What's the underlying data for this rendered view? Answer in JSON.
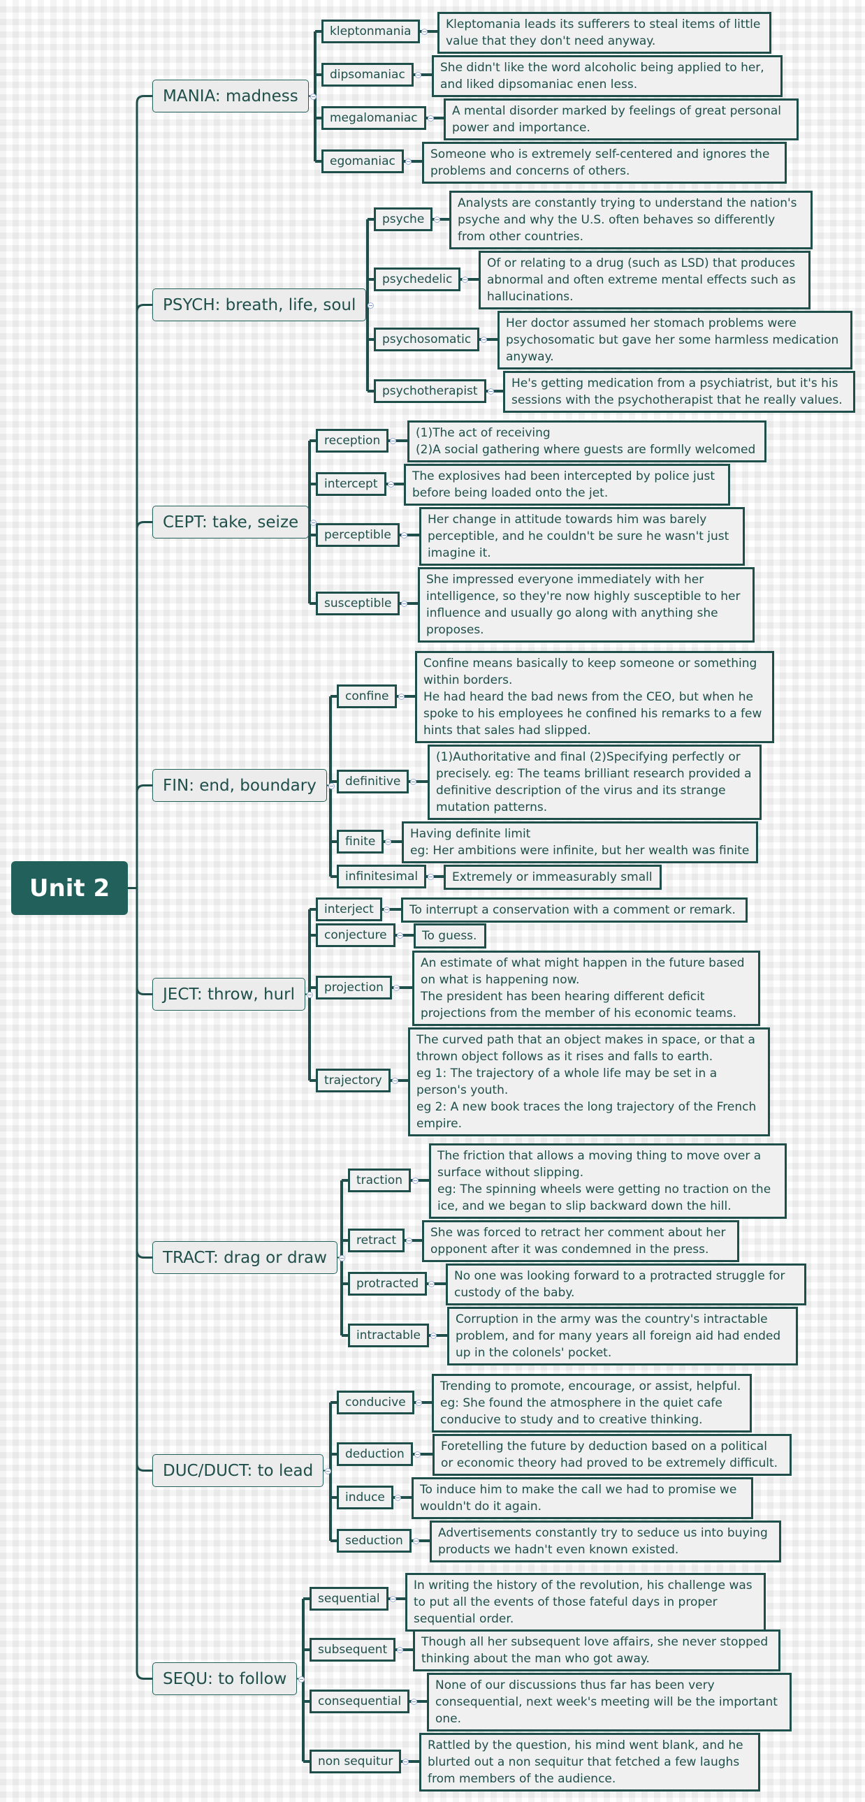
{
  "root": {
    "title": "Unit 2"
  },
  "colors": {
    "accent": "#22605b",
    "line": "#1f4f4a",
    "node_fill": "#ececec",
    "text": "#1f4f4a"
  },
  "categories": [
    {
      "title": "MANIA: madness",
      "children": [
        {
          "word": "kleptonmania",
          "definition": "Kleptomania leads its sufferers to steal items of little\nvalue that they don't need anyway."
        },
        {
          "word": "dipsomaniac",
          "definition": "She didn't like the word alcoholic being applied to her,\nand liked dipsomaniac enen less."
        },
        {
          "word": "megalomaniac",
          "definition": "A mental disorder marked by feelings of great personal\npower and importance."
        },
        {
          "word": "egomaniac",
          "definition": "Someone who is  extremely self-centered and ignores the\nproblems and concerns of others."
        }
      ]
    },
    {
      "title": "PSYCH: breath, life, soul",
      "children": [
        {
          "word": "psyche",
          "definition": "Analysts are constantly trying to understand the nation's\npsyche and why the U.S. often behaves so differently\nfrom other countries."
        },
        {
          "word": "psychedelic",
          "definition": "Of or relating to a drug (such as LSD) that produces\nabnormal and often extreme mental effects such as\nhallucinations."
        },
        {
          "word": "psychosomatic",
          "definition": "Her doctor assumed her stomach problems were\npsychosomatic but gave her some harmless medication\nanyway."
        },
        {
          "word": "psychotherapist",
          "definition": "He's getting medication from a psychiatrist, but it's his\nsessions with the psychotherapist that he really values."
        }
      ]
    },
    {
      "title": "CEPT: take, seize",
      "children": [
        {
          "word": "reception",
          "definition": "(1)The act of receiving\n(2)A social gathering where guests are formlly welcomed"
        },
        {
          "word": "intercept",
          "definition": "The explosives had been intercepted by police just\nbefore being loaded onto the jet."
        },
        {
          "word": "perceptible",
          "definition": "Her change in attitude towards him was barely\nperceptible, and he couldn't be sure he wasn't just\nimagine it."
        },
        {
          "word": "susceptible",
          "definition": "She impressed everyone immediately with her\nintelligence, so they're now highly susceptible to her\ninfluence and usually go along with anything she\nproposes."
        }
      ]
    },
    {
      "title": "FIN: end, boundary",
      "children": [
        {
          "word": "confine",
          "definition": "Confine means basically to keep someone or something\nwithin borders.\nHe had heard the bad news from the CEO, but when he\nspoke to his employees he confined his remarks to a few\nhints that sales had slipped."
        },
        {
          "word": "definitive",
          "definition": "(1)Authoritative and final (2)Specifying perfectly or\nprecisely. eg: The teams brilliant research provided a\ndefinitive description of the virus and its strange\nmutation patterns."
        },
        {
          "word": "finite",
          "definition": "Having definite limit\neg: Her ambitions were infinite, but her wealth was finite"
        },
        {
          "word": "infinitesimal",
          "definition": "Extremely or immeasurably small"
        }
      ]
    },
    {
      "title": "JECT: throw, hurl",
      "children": [
        {
          "word": "interject",
          "definition": "To interrupt a conservation with a comment or remark."
        },
        {
          "word": "conjecture",
          "definition": "To guess."
        },
        {
          "word": "projection",
          "definition": "An estimate of what might happen in the future based\non what is happening now.\nThe president has been hearing different deficit\nprojections from the member of his economic teams."
        },
        {
          "word": "trajectory",
          "definition": "The curved path that an object makes in space, or that a\nthrown object follows as it rises and falls to earth.\neg 1: The trajectory of a whole life may be set in a\nperson's youth.\neg 2: A new book traces the long trajectory of the French\nempire."
        }
      ]
    },
    {
      "title": "TRACT: drag or draw",
      "children": [
        {
          "word": "traction",
          "definition": "The friction that allows a moving thing to move over a\nsurface without slipping.\neg: The spinning wheels were getting no traction on the\nice, and we began to slip backward down the hill."
        },
        {
          "word": "retract",
          "definition": "She was forced to retract her comment about her\nopponent after it was condemned in the press."
        },
        {
          "word": "protracted",
          "definition": "No one was looking forward to a protracted struggle for\ncustody of the baby."
        },
        {
          "word": "intractable",
          "definition": "Corruption in the army was the country's intractable\nproblem, and for many years all foreign aid had ended\nup in the colonels' pocket."
        }
      ]
    },
    {
      "title": "DUC/DUCT: to lead",
      "children": [
        {
          "word": "conducive",
          "definition": "Trending to promote, encourage, or assist, helpful.\neg: She found the atmosphere in the quiet cafe\nconducive to study and to creative thinking."
        },
        {
          "word": "deduction",
          "definition": "Foretelling the future by deduction based on a political\nor economic theory had proved to be extremely difficult."
        },
        {
          "word": "induce",
          "definition": "To induce him to make the call we had to promise we\nwouldn't do it again."
        },
        {
          "word": "seduction",
          "definition": "Advertisements constantly try to seduce us into buying\nproducts we hadn't  even  known existed."
        }
      ]
    },
    {
      "title": "SEQU: to follow",
      "children": [
        {
          "word": "sequential",
          "definition": "In writing the history of the revolution, his challenge was\nto put all the events of those fateful days in proper\nsequential order."
        },
        {
          "word": "subsequent",
          "definition": "Though all her subsequent love affairs, she never stopped\nthinking about the man who got away."
        },
        {
          "word": "consequential",
          "definition": "None of our discussions thus far has been very\nconsequential, next week's meeting will be the important\none."
        },
        {
          "word": "non sequitur",
          "definition": "Rattled by the question, his mind went blank, and he\nblurted out a non sequitur that fetched a few laughs\nfrom members of the audience."
        }
      ]
    }
  ]
}
